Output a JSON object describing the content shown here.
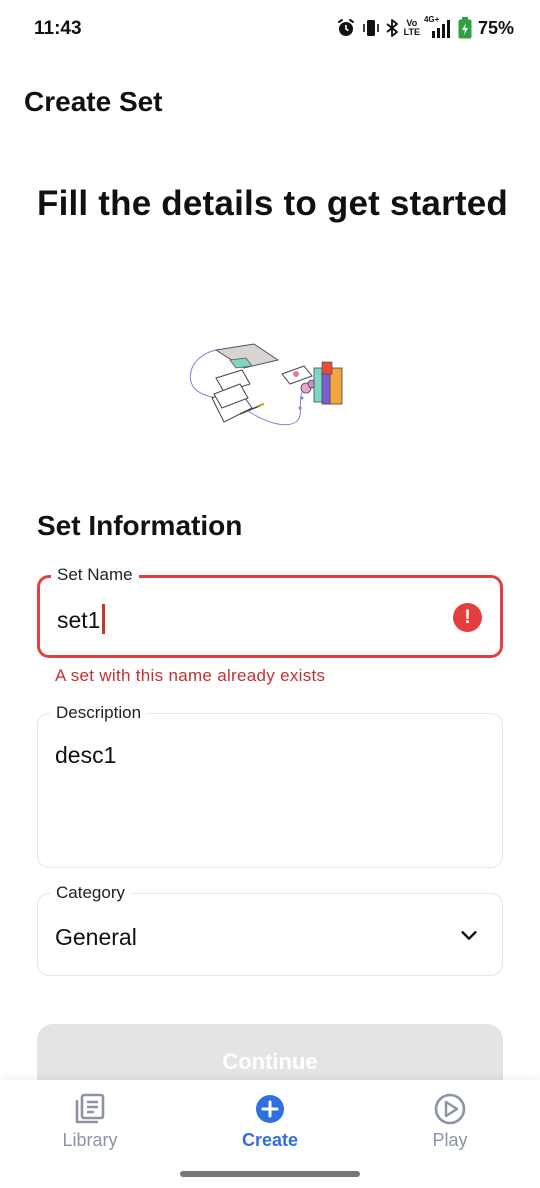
{
  "status_bar": {
    "time": "11:43",
    "network_label_top": "Vo",
    "network_label_bottom": "LTE",
    "signal_label": "4G+",
    "battery": "75%"
  },
  "app_bar": {
    "title": "Create Set"
  },
  "hero": {
    "title": "Fill the details to get started"
  },
  "form": {
    "section_title": "Set Information",
    "set_name": {
      "label": "Set Name",
      "value": "set1",
      "error": "A set with this name already exists"
    },
    "description": {
      "label": "Description",
      "value": "desc1"
    },
    "category": {
      "label": "Category",
      "value": "General"
    },
    "continue_label": "Continue"
  },
  "bottom_nav": {
    "items": [
      {
        "label": "Library",
        "icon": "library-icon",
        "active": false
      },
      {
        "label": "Create",
        "icon": "add-circle-icon",
        "active": true
      },
      {
        "label": "Play",
        "icon": "play-circle-icon",
        "active": false
      }
    ]
  },
  "colors": {
    "accent": "#2f6fe0",
    "error": "#e53e3e",
    "error_text": "#c53030",
    "disabled_button": "#e4e4e4",
    "inactive_nav": "#8a94a6"
  }
}
